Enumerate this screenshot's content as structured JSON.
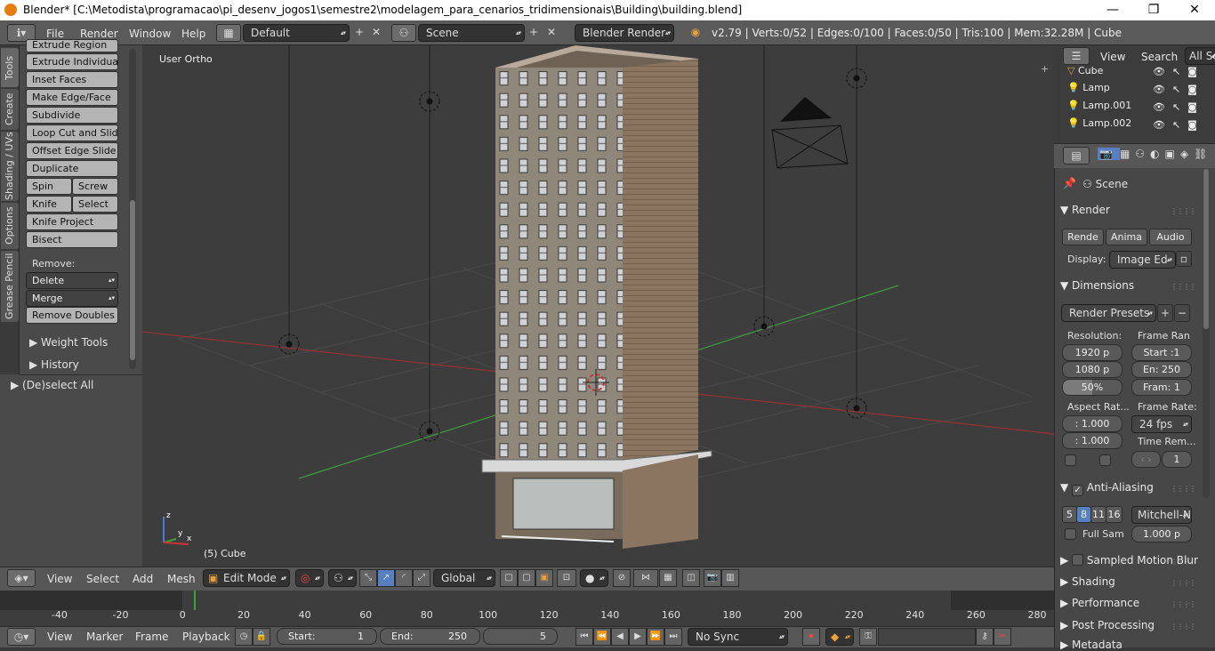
{
  "titlebar": {
    "title": "Blender* [C:\\Metodista\\programacao\\pi_desenv_jogos1\\semestre2\\modelagem_para_cenarios_tridimensionais\\Building\\building.blend]"
  },
  "info_header": {
    "menus": [
      "File",
      "Render",
      "Window",
      "Help"
    ],
    "layout": "Default",
    "scene": "Scene",
    "engine": "Blender Render",
    "stats": "v2.79 | Verts:0/52 | Edges:0/100 | Faces:0/50 | Tris:100 | Mem:32.28M | Cube"
  },
  "tool_tabs": [
    "Tools",
    "Create",
    "Shading / UVs",
    "Options",
    "Grease Pencil"
  ],
  "tools": {
    "buttons": [
      "Extrude Region",
      "Extrude Individual",
      "Inset Faces",
      "Make Edge/Face",
      "Subdivide",
      "Loop Cut and Slide",
      "Offset Edge Slide",
      "Duplicate"
    ],
    "spin": "Spin",
    "screw": "Screw",
    "knife": "Knife",
    "select": "Select",
    "knife_project": "Knife Project",
    "bisect": "Bisect",
    "remove_label": "Remove:",
    "delete": "Delete",
    "merge": "Merge",
    "remove_doubles": "Remove Doubles",
    "weight_tools": "Weight Tools",
    "history": "History",
    "deselect_all": "(De)select All"
  },
  "viewport": {
    "view_label": "User Ortho",
    "object_label": "(5) Cube",
    "axis_x": "x",
    "axis_y": "y",
    "axis_z": "z"
  },
  "outliner": {
    "menus": [
      "View",
      "Search",
      "All Sc"
    ],
    "items": [
      "Cube",
      "Lamp",
      "Lamp.001",
      "Lamp.002"
    ]
  },
  "properties": {
    "context": "Scene",
    "render_section": "Render",
    "render_buttons": [
      "Rende",
      "Anima",
      "Audio"
    ],
    "display_label": "Display:",
    "display_value": "Image Ed",
    "dimensions_section": "Dimensions",
    "presets": "Render Presets",
    "resolution_label": "Resolution:",
    "res_x": "1920 p",
    "res_y": "1080 p",
    "res_pct": "50%",
    "frame_range_label": "Frame Ran",
    "start": "Start :1",
    "end": "En: 250",
    "step": "Fram: 1",
    "aspect_label": "Aspect Rat...",
    "aspect_x": ": 1.000",
    "aspect_y": ": 1.000",
    "frame_rate_label": "Frame Rate:",
    "fps": "24 fps",
    "time_remap_label": "Time Rem...",
    "time_remap_value": "1",
    "aa_section": "Anti-Aliasing",
    "aa_samples": [
      "5",
      "8",
      "11",
      "16"
    ],
    "aa_filter": "Mitchell-N",
    "full_sample": "Full Sam",
    "filter_size": "1.000 p",
    "sampled_motion": "Sampled Motion Blur",
    "shading": "Shading",
    "performance": "Performance",
    "post_processing": "Post Processing",
    "metadata": "Metadata"
  },
  "view3d_header": {
    "menus": [
      "View",
      "Select",
      "Add",
      "Mesh"
    ],
    "mode": "Edit Mode",
    "orientation": "Global"
  },
  "timeline": {
    "ticks": [
      "-40",
      "-20",
      "0",
      "20",
      "40",
      "60",
      "80",
      "100",
      "120",
      "140",
      "160",
      "180",
      "200",
      "220",
      "240",
      "260",
      "280"
    ],
    "current_frame_marker": 5
  },
  "timeline_header": {
    "menus": [
      "View",
      "Marker",
      "Frame",
      "Playback"
    ],
    "start": "Start:",
    "start_val": "1",
    "end": "End:",
    "end_val": "250",
    "current": "5",
    "sync": "No Sync"
  },
  "colors": {
    "accent_blue": "#5680c2",
    "keyframe_green": "#3aa23a",
    "grid_red": "#9b3030",
    "grid_green": "#3d8f3d"
  }
}
